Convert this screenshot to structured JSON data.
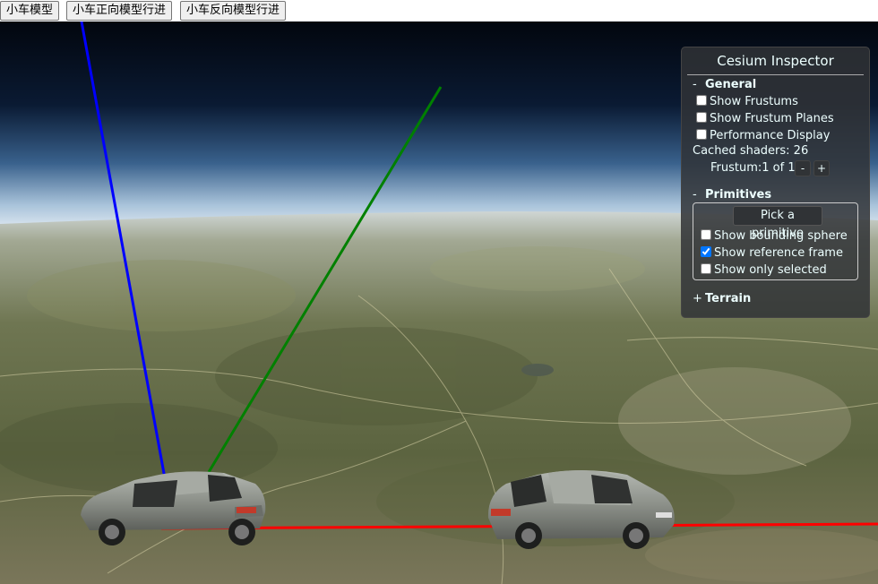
{
  "toolbar": {
    "btn_model": "小车模型",
    "btn_forward": "小车正向模型行进",
    "btn_reverse": "小车反向模型行进"
  },
  "inspector": {
    "title": "Cesium Inspector",
    "general": {
      "symbol": "-",
      "label": "General",
      "show_frustums": "Show Frustums",
      "show_frustums_checked": false,
      "show_frustum_planes": "Show Frustum Planes",
      "show_frustum_planes_checked": false,
      "performance_display": "Performance Display",
      "performance_display_checked": false,
      "cached_shaders": "Cached shaders: 26",
      "frustum": "Frustum:1 of 1",
      "frustum_minus": "-",
      "frustum_plus": "+"
    },
    "primitives": {
      "symbol": "-",
      "label": "Primitives",
      "pick_button": "Pick a primitive",
      "show_bounding_sphere": "Show bounding sphere",
      "show_bounding_sphere_checked": false,
      "show_reference_frame": "Show reference frame",
      "show_reference_frame_checked": true,
      "show_only_selected": "Show only selected",
      "show_only_selected_checked": false
    },
    "terrain": {
      "symbol": "+",
      "label": "Terrain"
    }
  },
  "scene_colors": {
    "axis_x": "#ff0000",
    "axis_y": "#008000",
    "axis_z": "#0000ff",
    "car_body": "#8c9089"
  }
}
